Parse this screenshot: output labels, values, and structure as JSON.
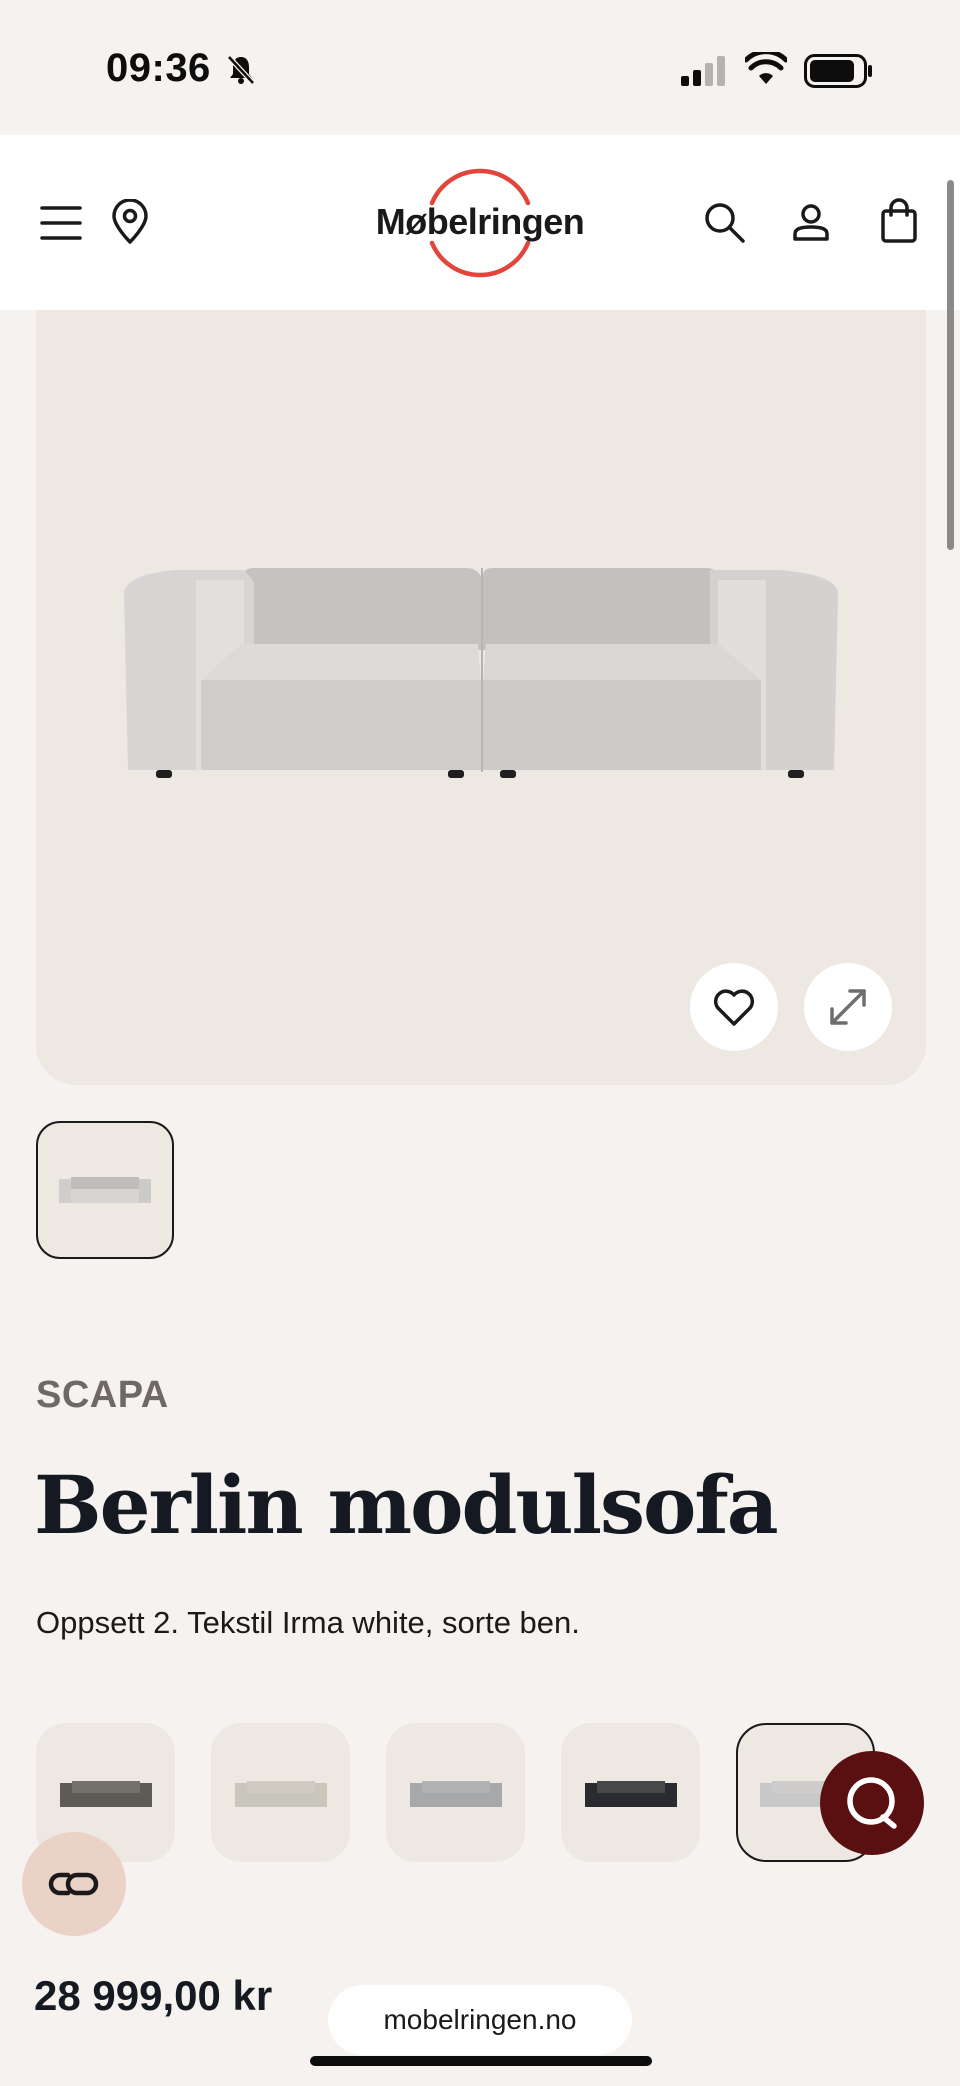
{
  "status_bar": {
    "time": "09:36"
  },
  "header": {
    "logo_text": "Møbelringen",
    "icons": [
      "menu-icon",
      "location-pin-icon",
      "search-icon",
      "account-icon",
      "shopping-bag-icon"
    ]
  },
  "product": {
    "brand": "SCAPA",
    "title": "Berlin modulsofa",
    "description": "Oppsett 2. Tekstil Irma white, sorte ben.",
    "price": "28 999,00 kr"
  },
  "variants": [
    {
      "color": "#5e5a55",
      "selected": false
    },
    {
      "color": "#c9c6bc",
      "selected": false
    },
    {
      "color": "#a7a8aa",
      "selected": false
    },
    {
      "color": "#2a2b2e",
      "selected": false
    },
    {
      "color": "#c8c8c8",
      "selected": true
    }
  ],
  "browser": {
    "url": "mobelringen.no"
  },
  "colors": {
    "background": "#f6f2ef",
    "image_bg": "#ede8e1",
    "logo_accent": "#e2453c",
    "chat_button": "#5a0f10",
    "co_button": "#ead3c6"
  }
}
